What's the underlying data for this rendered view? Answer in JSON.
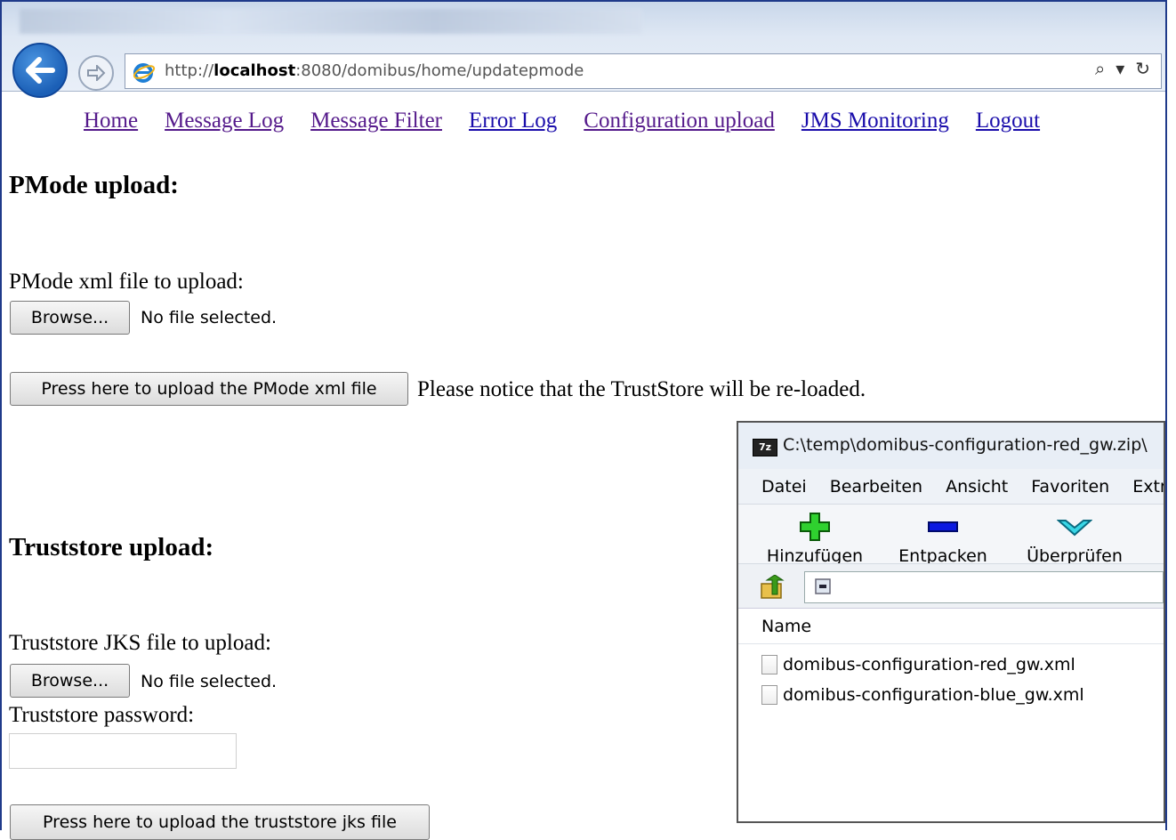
{
  "browser": {
    "url_prefix": "http://",
    "url_host": "localhost",
    "url_rest": ":8080/domibus/home/updatepmode",
    "search_glyph": "⌕",
    "dropdown_glyph": "▾",
    "refresh_glyph": "↻"
  },
  "nav": [
    "Home",
    "Message Log",
    "Message Filter",
    "Error Log",
    "Configuration upload",
    "JMS Monitoring",
    "Logout"
  ],
  "pmode": {
    "heading": "PMode upload:",
    "file_label": "PMode xml file to upload:",
    "browse_label": "Browse...",
    "no_file": "No file selected.",
    "upload_label": "Press here to upload the PMode xml file",
    "notice": "Please notice that the TrustStore will be re-loaded."
  },
  "truststore": {
    "heading": "Truststore upload:",
    "file_label": "Truststore JKS file to upload:",
    "browse_label": "Browse...",
    "no_file": "No file selected.",
    "password_label": "Truststore password:",
    "password_value": "",
    "upload_label": "Press here to upload the truststore jks file"
  },
  "zip_window": {
    "logo": "7z",
    "title": "C:\\temp\\domibus-configuration-red_gw.zip\\",
    "menu": [
      "Datei",
      "Bearbeiten",
      "Ansicht",
      "Favoriten",
      "Extras"
    ],
    "toolbar": [
      "Hinzufügen",
      "Entpacken",
      "Überprüfen"
    ],
    "column_name": "Name",
    "files": [
      "domibus-configuration-red_gw.xml",
      "domibus-configuration-blue_gw.xml"
    ]
  },
  "colors": {
    "link": "#1a0dab",
    "visited": "#551a8b",
    "frame": "#1f3a8a"
  }
}
